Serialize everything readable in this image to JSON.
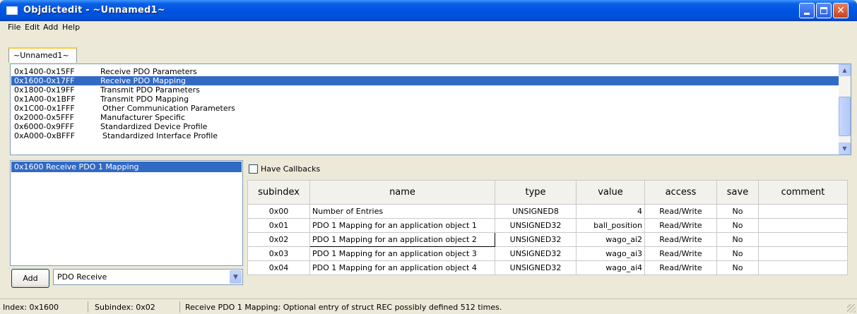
{
  "window": {
    "title": "Objdictedit - ~Unnamed1~",
    "controls": {
      "minimize_icon": "minimize-icon",
      "maximize_icon": "maximize-icon",
      "close_glyph": "✕"
    }
  },
  "menu": {
    "items": [
      "File",
      "Edit",
      "Add",
      "Help"
    ]
  },
  "tabs": [
    {
      "label": "~Unnamed1~",
      "active": true
    }
  ],
  "index_ranges": [
    {
      "range": "0x1400-0x15FF",
      "name": "Receive PDO Parameters",
      "selected": false
    },
    {
      "range": "0x1600-0x17FF",
      "name": "Receive PDO Mapping",
      "selected": true
    },
    {
      "range": "0x1800-0x19FF",
      "name": "Transmit PDO Parameters",
      "selected": false
    },
    {
      "range": "0x1A00-0x1BFF",
      "name": "Transmit PDO Mapping",
      "selected": false
    },
    {
      "range": "0x1C00-0x1FFF",
      "name": "Other Communication Parameters",
      "selected": false
    },
    {
      "range": "0x2000-0x5FFF",
      "name": "Manufacturer Specific",
      "selected": false
    },
    {
      "range": "0x6000-0x9FFF",
      "name": "Standardized Device Profile",
      "selected": false
    },
    {
      "range": "0xA000-0xBFFF",
      "name": "Standardized Interface Profile",
      "selected": false
    }
  ],
  "entries": [
    {
      "label": "0x1600  Receive PDO 1 Mapping",
      "selected": true
    }
  ],
  "add": {
    "button_label": "Add",
    "profile_value": "PDO Receive"
  },
  "have_callbacks": {
    "label": "Have Callbacks",
    "checked": false
  },
  "table": {
    "headers": [
      "subindex",
      "name",
      "type",
      "value",
      "access",
      "save",
      "comment"
    ],
    "rows": [
      {
        "subindex": "0x00",
        "name": "Number of Entries",
        "type": "UNSIGNED8",
        "value": "4",
        "access": "Read/Write",
        "save": "No",
        "comment": ""
      },
      {
        "subindex": "0x01",
        "name": "PDO 1 Mapping for an application object 1",
        "type": "UNSIGNED32",
        "value": "ball_position",
        "access": "Read/Write",
        "save": "No",
        "comment": ""
      },
      {
        "subindex": "0x02",
        "name": "PDO 1 Mapping for an application object 2",
        "type": "UNSIGNED32",
        "value": "wago_ai2",
        "access": "Read/Write",
        "save": "No",
        "comment": ""
      },
      {
        "subindex": "0x03",
        "name": "PDO 1 Mapping for an application object 3",
        "type": "UNSIGNED32",
        "value": "wago_ai3",
        "access": "Read/Write",
        "save": "No",
        "comment": ""
      },
      {
        "subindex": "0x04",
        "name": "PDO 1 Mapping for an application object 4",
        "type": "UNSIGNED32",
        "value": "wago_ai4",
        "access": "Read/Write",
        "save": "No",
        "comment": ""
      }
    ]
  },
  "status": {
    "index": "Index: 0x1600",
    "subindex": "Subindex: 0x02",
    "message": "Receive PDO 1 Mapping: Optional entry of struct REC possibly defined 512 times."
  },
  "colors": {
    "selection": "#316ac5",
    "titlebar": "#0054e3",
    "window_bg": "#ece9d8"
  }
}
